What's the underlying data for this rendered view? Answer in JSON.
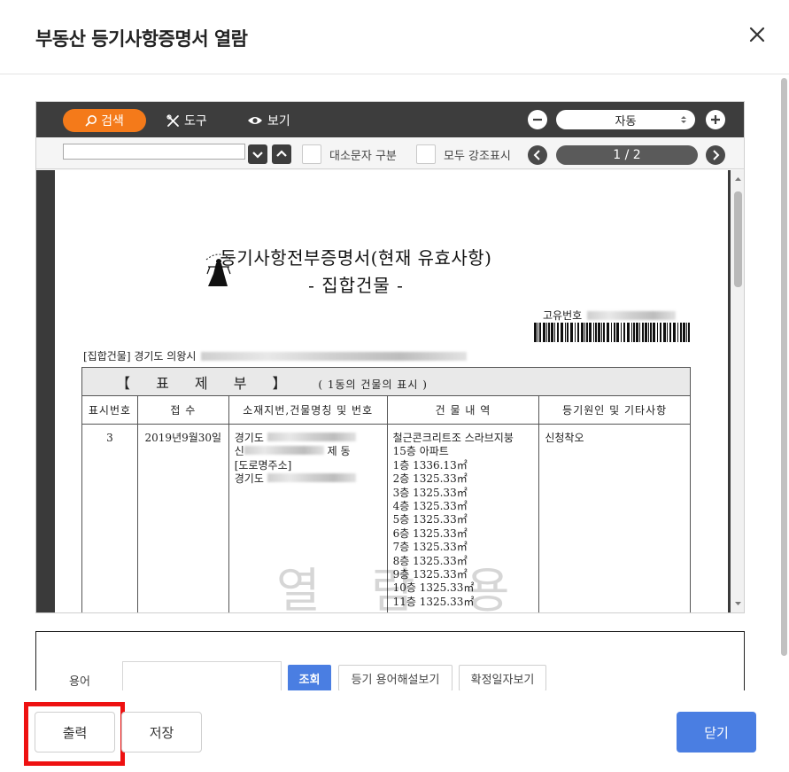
{
  "modal": {
    "title": "부동산 등기사항증명서 열람",
    "close_icon": "close-icon"
  },
  "viewer": {
    "toolbar": {
      "search_label": "검색",
      "tools_label": "도구",
      "view_label": "보기",
      "zoom_value": "자동"
    },
    "find": {
      "input_value": "",
      "case_label": "대소문자 구분",
      "highlight_label": "모두 강조표시",
      "page_indicator": "1 / 2"
    },
    "document": {
      "title": "등기사항전부증명서(현재 유효사항)",
      "subtitle": "- 집합건물 -",
      "unique_no_label": "고유번호",
      "address_line": "[집합건물] 경기도 의왕시",
      "section_label": "【  표  제  부  】",
      "section_sub": "( 1동의 건물의 표시 )",
      "columns": [
        "표시번호",
        "접  수",
        "소재지번,건물명칭 및 번호",
        "건 물 내 역",
        "등기원인 및 기타사항"
      ],
      "row": {
        "no": "3",
        "received": "2019년9월30일",
        "location_lines": [
          "경기도",
          "신",
          "[도로명주소]",
          "경기도"
        ],
        "location_suffix": "제 동",
        "building_lines": [
          "철근콘크리트조 스라브지붕",
          "15층 아파트",
          "1층 1336.13㎡",
          "2층 1325.33㎡",
          "3층 1325.33㎡",
          "4층 1325.33㎡",
          "5층 1325.33㎡",
          "6층 1325.33㎡",
          "7층 1325.33㎡",
          "8층 1325.33㎡",
          "9층 1325.33㎡",
          "10층 1325.33㎡",
          "11층 1325.33㎡"
        ],
        "cause": "신청착오"
      },
      "watermark": "열 람 용"
    }
  },
  "terms": {
    "label": "용어",
    "input_value": "",
    "lookup_label": "조회",
    "glossary_label": "등기 용어해설보기",
    "confirm_date_label": "확정일자보기"
  },
  "footer": {
    "print_label": "출력",
    "save_label": "저장",
    "close_label": "닫기"
  },
  "colors": {
    "accent_orange": "#f47a1a",
    "primary_blue": "#4a7ee2",
    "highlight_red": "#ee1111",
    "toolbar_dark": "#3d3d3d"
  }
}
